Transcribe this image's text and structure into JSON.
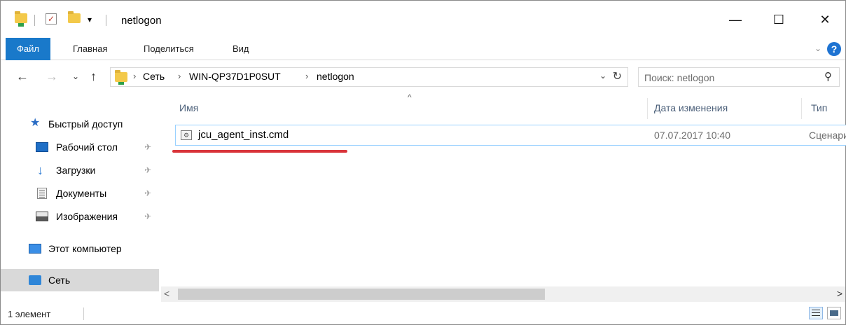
{
  "window": {
    "title": "netlogon",
    "minimize_glyph": "—",
    "maximize_glyph": "☐",
    "close_glyph": "✕"
  },
  "quick_access_toolbar": {
    "dropdown_glyph": "▾"
  },
  "ribbon": {
    "tabs": [
      "Файл",
      "Главная",
      "Поделиться",
      "Вид"
    ],
    "expand_glyph": "⌄",
    "help_glyph": "?"
  },
  "navigation": {
    "back_glyph": "←",
    "forward_glyph": "→",
    "recent_glyph": "⌄",
    "up_glyph": "↑",
    "breadcrumb": [
      "Сеть",
      "WIN-QP37D1P0SUT",
      "netlogon"
    ],
    "breadcrumb_sep": "›",
    "dropdown_glyph": "⌄",
    "refresh_glyph": "↻"
  },
  "search": {
    "placeholder": "Поиск: netlogon",
    "icon_glyph": "⚲"
  },
  "nav_pane": {
    "quick_access": "Быстрый доступ",
    "items": [
      {
        "label": "Рабочий стол",
        "pinned": true
      },
      {
        "label": "Загрузки",
        "pinned": true
      },
      {
        "label": "Документы",
        "pinned": true
      },
      {
        "label": "Изображения",
        "pinned": true
      }
    ],
    "this_pc": "Этот компьютер",
    "network": "Сеть",
    "pin_glyph": "✈"
  },
  "file_list": {
    "sort_glyph": "^",
    "columns": {
      "name": "Имя",
      "date": "Дата изменения",
      "type": "Тип"
    },
    "rows": [
      {
        "name": "jcu_agent_inst.cmd",
        "date": "07.07.2017 10:40",
        "type": "Сценарий"
      }
    ]
  },
  "scrollbar": {
    "left_glyph": "<",
    "right_glyph": ">"
  },
  "status": {
    "count": "1 элемент"
  },
  "colors": {
    "accent": "#1979ca",
    "selection_border": "#99d1ff",
    "highlight_red": "#d9343a"
  }
}
